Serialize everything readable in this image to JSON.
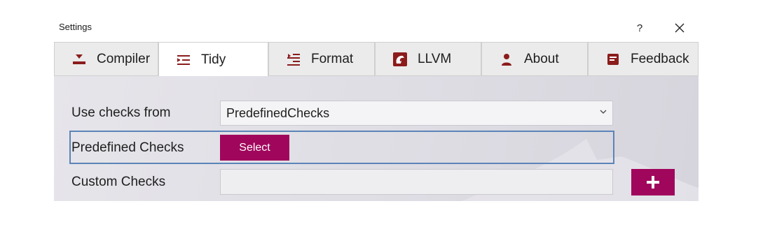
{
  "window": {
    "title": "Settings",
    "help_label": "?",
    "close_label": "✕"
  },
  "tabs": [
    {
      "label": "Compiler",
      "icon": "download-icon",
      "active": false
    },
    {
      "label": "Tidy",
      "icon": "list-lines-icon",
      "active": true
    },
    {
      "label": "Format",
      "icon": "format-indent-icon",
      "active": false
    },
    {
      "label": "LLVM",
      "icon": "llvm-dragon-icon",
      "active": false
    },
    {
      "label": "About",
      "icon": "person-icon",
      "active": false
    },
    {
      "label": "Feedback",
      "icon": "feedback-note-icon",
      "active": false
    }
  ],
  "form": {
    "use_checks_label": "Use checks from",
    "use_checks_value": "PredefinedChecks",
    "predefined_label": "Predefined Checks",
    "select_button": "Select",
    "custom_label": "Custom Checks",
    "custom_value": "",
    "add_button": "+"
  },
  "colors": {
    "accent": "#a0065c",
    "icon": "#8b1c1c",
    "focus": "#5b84b8"
  }
}
